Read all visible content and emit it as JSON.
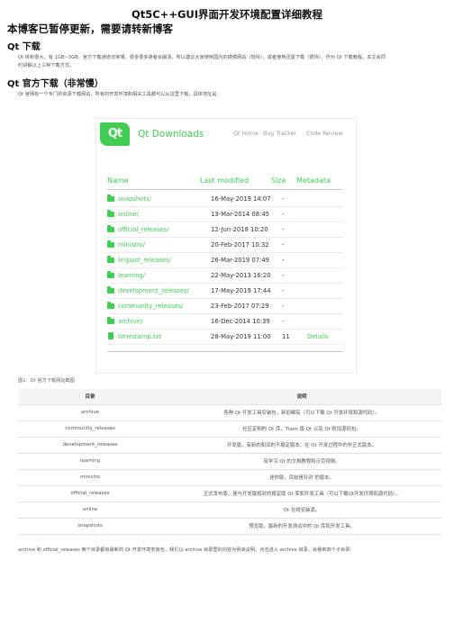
{
  "doc_title": "Qt5C++GUI界面开发环境配置详细教程",
  "notice": "本博客已暂停更新，需要请转新博客",
  "sections": {
    "download": "Qt 下载",
    "official": "Qt 官方下载（非常慢）"
  },
  "paragraphs": {
    "intro_1": "Qt 体积很大，有 1GB~3GB，官方下载通道非常慢，很多很多读者会崩溃，所以建议大家使用国内的镜像网站（较快），或者使用迅雷下载（很快）。作为 Qt 下载教程，本文会同",
    "intro_2": "时讲解以上三种下载方式。",
    "official_intro": "Qt 官网有一个专门的资源下载网站，所有的开发环境和相关工具都可以从这里下载，具体地址是："
  },
  "screenshot": {
    "logo": "Qt",
    "title": "Qt Downloads",
    "nav": [
      "Qt Home",
      "Bug Tracker",
      "Code Review"
    ],
    "accent": "#41cd52",
    "columns": [
      "Name",
      "Last modified",
      "Size",
      "Metadata"
    ],
    "rows": [
      {
        "icon": "folder-icon",
        "name": "snapshots/",
        "modified": "16-May-2019 14:07",
        "size": "-",
        "meta": ""
      },
      {
        "icon": "folder-icon",
        "name": "online/",
        "modified": "13-Mar-2014 08:45",
        "size": "-",
        "meta": ""
      },
      {
        "icon": "folder-icon",
        "name": "official_releases/",
        "modified": "12-Jun-2018 10:20",
        "size": "-",
        "meta": ""
      },
      {
        "icon": "folder-icon",
        "name": "ministro/",
        "modified": "20-Feb-2017 10:32",
        "size": "-",
        "meta": ""
      },
      {
        "icon": "folder-icon",
        "name": "linguist_releases/",
        "modified": "26-Mar-2019 07:49",
        "size": "-",
        "meta": ""
      },
      {
        "icon": "folder-icon",
        "name": "learning/",
        "modified": "22-May-2013 16:20",
        "size": "-",
        "meta": ""
      },
      {
        "icon": "folder-icon",
        "name": "development_releases/",
        "modified": "17-May-2019 17:44",
        "size": "-",
        "meta": ""
      },
      {
        "icon": "folder-icon",
        "name": "community_releases/",
        "modified": "23-Feb-2017 07:29",
        "size": "-",
        "meta": ""
      },
      {
        "icon": "folder-icon",
        "name": "archive/",
        "modified": "16-Dec-2014 10:39",
        "size": "-",
        "meta": ""
      },
      {
        "icon": "file-icon",
        "name": "timestamp.txt",
        "modified": "28-May-2019 11:00",
        "size": "11",
        "meta": "Details"
      }
    ]
  },
  "caption": "图1：Qt 官方下载网站截图",
  "table": {
    "headers": [
      "目录",
      "说明"
    ],
    "rows": [
      {
        "dir": "archive",
        "desc": "各种 Qt 开发工具安装包，新旧都有（可以下载 Qt 开发环境和源代码）。"
      },
      {
        "dir": "community_releases",
        "desc": "社区定制的 Qt 库，Tizen 版 Qt 以及 Qt 附加源码包。"
      },
      {
        "dir": "development_releases",
        "desc": "开发版，有新的和旧的不稳定版本，在 Qt 开发过程中的非正式版本。"
      },
      {
        "dir": "learning",
        "desc": "有学习 Qt 的文档教程和示范视频。"
      },
      {
        "dir": "ministro",
        "desc": "迷你版，目前是针对 的版本。"
      },
      {
        "dir": "official_releases",
        "desc": "正式发布版，是与开发版相对的稳定版 Qt 库和开发工具（可以下载Qt开发环境和源代码）。"
      },
      {
        "dir": "online",
        "desc": "Qt 在线安装源。"
      },
      {
        "dir": "snapshots",
        "desc": "预览版，最新的开发测试中的 Qt 库和开发工具。"
      }
    ]
  },
  "footer_text": "archive 和 official_releases 两个目录都有最新的 Qt 开发环境安装包，我们以 archive 目录里的内容为例来说明。点击进入 archive 目录，会看到四个子目录："
}
